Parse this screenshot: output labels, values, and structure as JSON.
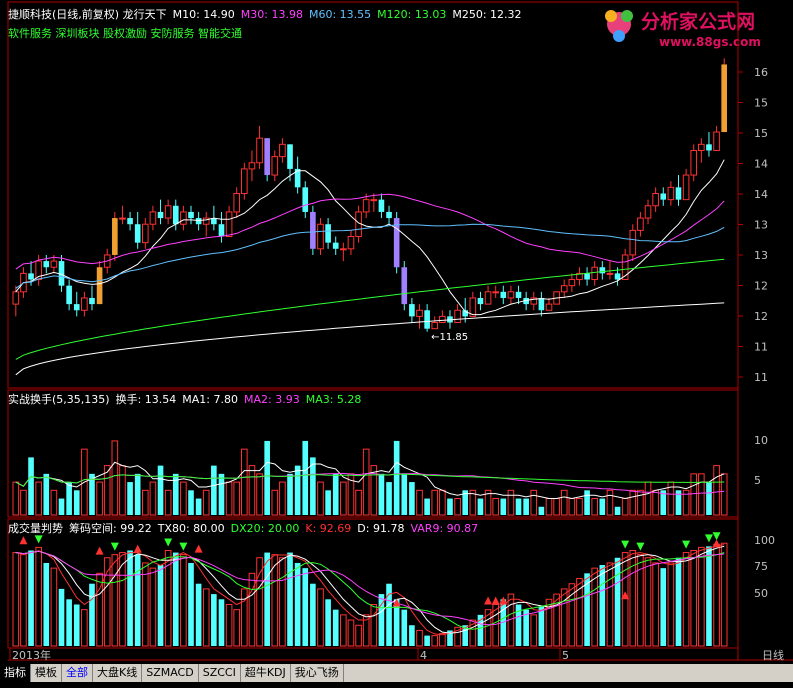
{
  "main_header": {
    "title": "捷顺科技(日线,前复权) 龙行天下",
    "m10": "M10: 14.90",
    "m30": "M30: 13.98",
    "m60": "M60: 13.55",
    "m120": "M120: 13.03",
    "m250": "M250: 12.32",
    "sectors": "软件服务 深圳板块 股权激励 安防服务 智能交通"
  },
  "watermark": {
    "name": "分析家公式网",
    "url": "www.88gs.com"
  },
  "panel2_header": {
    "name": "实战换手(5,35,135)",
    "turnover": "换手: 13.54",
    "ma1": "MA1: 7.80",
    "ma2": "MA2: 3.93",
    "ma3": "MA3: 5.28"
  },
  "panel3_header": {
    "name": "成交量判势",
    "chip": "筹码空间: 99.22",
    "tx80": "TX80: 80.00",
    "dx20": "DX20: 20.00",
    "k": "K: 92.69",
    "d": "D: 91.78",
    "var9": "VAR9: 90.87"
  },
  "low_annotation": "←11.85",
  "colors": {
    "up": "#ff3232",
    "down": "#54ffff",
    "up_big": "#f0a030",
    "down_big": "#a080ff",
    "m10": "#ffffff",
    "m30": "#ff40ff",
    "m60": "#60c0ff",
    "m120": "#30ff30",
    "m250": "#ffffff"
  },
  "time_axis": {
    "labels": [
      "2013年",
      "4",
      "5",
      "日线"
    ]
  },
  "bottom_tabs": [
    "指标",
    "模板",
    "全部",
    "大盘K线",
    "SZMACD",
    "SZCCI",
    "超牛KDJ",
    "我心飞扬"
  ],
  "chart_data": [
    {
      "type": "candlestick",
      "title": "捷顺科技(日线,前复权) 龙行天下",
      "y_ticks": [
        "16",
        "15",
        "15",
        "14",
        "14",
        "13",
        "13",
        "12",
        "12",
        "11",
        "11"
      ],
      "ylim": [
        11.0,
        16.5
      ],
      "low_marker": 11.85,
      "ohlc": [
        [
          12.3,
          12.6,
          12.1,
          12.5
        ],
        [
          12.5,
          12.9,
          12.4,
          12.8
        ],
        [
          12.8,
          13.0,
          12.6,
          12.7
        ],
        [
          12.7,
          13.1,
          12.6,
          13.0
        ],
        [
          13.0,
          13.1,
          12.8,
          12.9
        ],
        [
          12.9,
          13.1,
          12.8,
          13.0
        ],
        [
          13.0,
          13.1,
          12.5,
          12.6
        ],
        [
          12.6,
          12.7,
          12.2,
          12.3
        ],
        [
          12.3,
          12.5,
          12.1,
          12.2
        ],
        [
          12.2,
          12.5,
          12.1,
          12.4
        ],
        [
          12.4,
          12.6,
          12.2,
          12.3
        ],
        [
          12.3,
          13.0,
          12.3,
          12.9
        ],
        [
          12.9,
          13.2,
          12.8,
          13.1
        ],
        [
          13.1,
          13.8,
          13.0,
          13.7
        ],
        [
          13.7,
          13.9,
          13.6,
          13.7
        ],
        [
          13.7,
          13.8,
          13.5,
          13.6
        ],
        [
          13.6,
          13.8,
          13.2,
          13.3
        ],
        [
          13.3,
          13.7,
          13.2,
          13.6
        ],
        [
          13.6,
          13.9,
          13.5,
          13.8
        ],
        [
          13.8,
          14.0,
          13.6,
          13.7
        ],
        [
          13.7,
          14.0,
          13.6,
          13.9
        ],
        [
          13.9,
          14.0,
          13.5,
          13.6
        ],
        [
          13.6,
          13.9,
          13.5,
          13.8
        ],
        [
          13.8,
          13.9,
          13.6,
          13.7
        ],
        [
          13.7,
          13.8,
          13.5,
          13.6
        ],
        [
          13.6,
          13.8,
          13.4,
          13.7
        ],
        [
          13.7,
          13.9,
          13.5,
          13.6
        ],
        [
          13.6,
          13.8,
          13.3,
          13.4
        ],
        [
          13.4,
          13.9,
          13.4,
          13.8
        ],
        [
          13.8,
          14.2,
          13.7,
          14.1
        ],
        [
          14.1,
          14.6,
          14.0,
          14.5
        ],
        [
          14.5,
          14.8,
          14.3,
          14.6
        ],
        [
          14.6,
          15.2,
          14.5,
          15.0
        ],
        [
          15.0,
          15.0,
          14.3,
          14.4
        ],
        [
          14.4,
          14.8,
          14.3,
          14.7
        ],
        [
          14.7,
          15.0,
          14.6,
          14.9
        ],
        [
          14.9,
          14.9,
          14.3,
          14.5
        ],
        [
          14.5,
          14.7,
          14.1,
          14.2
        ],
        [
          14.2,
          14.3,
          13.7,
          13.8
        ],
        [
          13.8,
          13.9,
          13.1,
          13.2
        ],
        [
          13.2,
          13.7,
          13.1,
          13.6
        ],
        [
          13.6,
          13.7,
          13.2,
          13.3
        ],
        [
          13.3,
          13.4,
          13.1,
          13.2
        ],
        [
          13.2,
          13.3,
          13.0,
          13.2
        ],
        [
          13.2,
          13.5,
          13.1,
          13.4
        ],
        [
          13.4,
          13.9,
          13.3,
          13.8
        ],
        [
          13.8,
          14.1,
          13.7,
          14.0
        ],
        [
          14.0,
          14.1,
          13.8,
          14.0
        ],
        [
          14.0,
          14.1,
          13.7,
          13.8
        ],
        [
          13.8,
          13.9,
          13.6,
          13.7
        ],
        [
          13.7,
          13.8,
          12.8,
          12.9
        ],
        [
          12.9,
          13.0,
          12.2,
          12.3
        ],
        [
          12.3,
          12.4,
          12.0,
          12.1
        ],
        [
          12.1,
          12.3,
          11.9,
          12.2
        ],
        [
          12.2,
          12.3,
          11.85,
          11.9
        ],
        [
          11.9,
          12.1,
          11.9,
          12.0
        ],
        [
          12.0,
          12.2,
          12.0,
          12.1
        ],
        [
          12.1,
          12.2,
          11.9,
          12.0
        ],
        [
          12.0,
          12.3,
          12.0,
          12.2
        ],
        [
          12.2,
          12.4,
          12.0,
          12.1
        ],
        [
          12.1,
          12.5,
          12.1,
          12.4
        ],
        [
          12.4,
          12.5,
          12.2,
          12.3
        ],
        [
          12.3,
          12.6,
          12.3,
          12.5
        ],
        [
          12.5,
          12.6,
          12.4,
          12.5
        ],
        [
          12.5,
          12.6,
          12.3,
          12.4
        ],
        [
          12.4,
          12.6,
          12.3,
          12.5
        ],
        [
          12.5,
          12.6,
          12.3,
          12.4
        ],
        [
          12.4,
          12.5,
          12.2,
          12.3
        ],
        [
          12.3,
          12.5,
          12.2,
          12.4
        ],
        [
          12.4,
          12.5,
          12.1,
          12.2
        ],
        [
          12.2,
          12.4,
          12.2,
          12.3
        ],
        [
          12.3,
          12.5,
          12.3,
          12.5
        ],
        [
          12.5,
          12.7,
          12.4,
          12.6
        ],
        [
          12.6,
          12.8,
          12.5,
          12.7
        ],
        [
          12.7,
          12.9,
          12.6,
          12.8
        ],
        [
          12.8,
          12.9,
          12.6,
          12.7
        ],
        [
          12.7,
          13.0,
          12.6,
          12.9
        ],
        [
          12.9,
          13.0,
          12.7,
          12.8
        ],
        [
          12.8,
          13.0,
          12.7,
          12.8
        ],
        [
          12.8,
          12.9,
          12.6,
          12.7
        ],
        [
          12.7,
          13.2,
          12.7,
          13.1
        ],
        [
          13.1,
          13.6,
          13.0,
          13.5
        ],
        [
          13.5,
          13.8,
          13.4,
          13.7
        ],
        [
          13.7,
          14.0,
          13.6,
          13.9
        ],
        [
          13.9,
          14.2,
          13.8,
          14.1
        ],
        [
          14.1,
          14.2,
          13.9,
          14.0
        ],
        [
          14.0,
          14.3,
          13.9,
          14.2
        ],
        [
          14.2,
          14.4,
          13.9,
          14.0
        ],
        [
          14.0,
          14.5,
          14.0,
          14.4
        ],
        [
          14.4,
          14.9,
          14.3,
          14.8
        ],
        [
          14.8,
          15.0,
          14.6,
          14.9
        ],
        [
          14.9,
          15.1,
          14.7,
          14.8
        ],
        [
          14.8,
          15.2,
          14.8,
          15.1
        ],
        [
          15.1,
          16.3,
          15.1,
          16.2
        ]
      ],
      "ma_levels": {
        "m10": 14.9,
        "m30": 13.98,
        "m60": 13.55,
        "m120": 13.03,
        "m250": 12.32
      }
    },
    {
      "type": "bar",
      "title": "实战换手(5,35,135)",
      "y_ticks": [
        "10",
        "5"
      ],
      "ylim": [
        0,
        13
      ],
      "values": [
        4,
        3,
        7,
        4,
        5,
        3,
        2,
        4,
        3,
        8,
        5,
        4,
        6,
        9,
        6,
        4,
        5,
        3,
        4,
        6,
        3,
        5,
        4,
        3,
        2,
        3,
        6,
        5,
        4,
        4,
        8,
        6,
        5,
        9,
        3,
        4,
        5,
        6,
        9,
        7,
        4,
        3,
        5,
        4,
        5,
        3,
        8,
        6,
        5,
        4,
        9,
        5,
        4,
        3,
        2,
        3,
        3,
        2,
        2,
        3,
        3,
        2,
        3,
        2,
        2,
        3,
        2,
        2,
        3,
        1,
        2,
        2,
        3,
        2,
        2,
        3,
        2,
        2,
        3,
        1,
        2,
        3,
        3,
        4,
        3,
        3,
        4,
        3,
        3,
        5,
        5,
        4,
        6,
        5,
        6,
        7,
        8,
        12,
        13
      ]
    },
    {
      "type": "bar",
      "title": "成交量判势",
      "y_ticks": [
        "100",
        "75",
        "50"
      ],
      "ylim": [
        0,
        105
      ],
      "values": [
        90,
        88,
        92,
        95,
        80,
        75,
        55,
        45,
        40,
        35,
        60,
        70,
        85,
        88,
        90,
        92,
        88,
        80,
        75,
        78,
        92,
        90,
        88,
        80,
        60,
        55,
        50,
        45,
        40,
        35,
        55,
        70,
        85,
        90,
        88,
        85,
        90,
        80,
        75,
        60,
        55,
        45,
        35,
        30,
        25,
        20,
        30,
        40,
        50,
        60,
        45,
        35,
        20,
        15,
        10,
        10,
        12,
        15,
        18,
        20,
        25,
        30,
        35,
        40,
        45,
        50,
        40,
        35,
        30,
        38,
        45,
        50,
        55,
        60,
        65,
        70,
        75,
        78,
        80,
        85,
        90,
        92,
        88,
        85,
        80,
        75,
        80,
        85,
        90,
        92,
        95,
        96,
        98,
        99
      ]
    }
  ]
}
